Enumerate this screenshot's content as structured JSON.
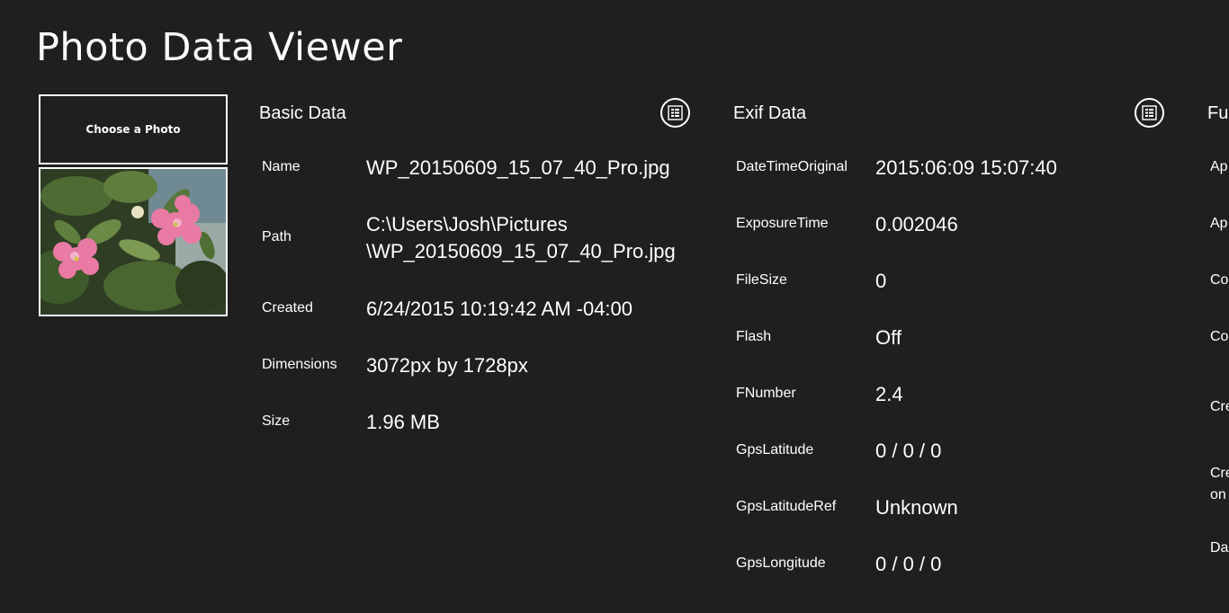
{
  "app": {
    "title": "Photo Data Viewer",
    "choose_button": "Choose a Photo"
  },
  "basic": {
    "header": "Basic Data",
    "rows": [
      {
        "label": "Name",
        "value": "WP_20150609_15_07_40_Pro.jpg"
      },
      {
        "label": "Path",
        "value_line1": "C:\\Users\\Josh\\Pictures",
        "value_line2": "\\WP_20150609_15_07_40_Pro.jpg"
      },
      {
        "label": "Created",
        "value": "6/24/2015 10:19:42 AM -04:00"
      },
      {
        "label": "Dimensions",
        "value": "3072px by 1728px"
      },
      {
        "label": "Size",
        "value": "1.96 MB"
      }
    ]
  },
  "exif": {
    "header": "Exif Data",
    "rows": [
      {
        "label": "DateTimeOriginal",
        "value": "2015:06:09 15:07:40"
      },
      {
        "label": "ExposureTime",
        "value": "0.002046"
      },
      {
        "label": "FileSize",
        "value": "0"
      },
      {
        "label": "Flash",
        "value": "Off"
      },
      {
        "label": "FNumber",
        "value": "2.4"
      },
      {
        "label": "GpsLatitude",
        "value": "0 / 0 / 0"
      },
      {
        "label": "GpsLatitudeRef",
        "value": "Unknown"
      },
      {
        "label": "GpsLongitude",
        "value": "0 / 0 / 0"
      }
    ]
  },
  "full": {
    "header": "Fu",
    "labels": [
      "Ap",
      "Ap",
      "Co",
      "Co",
      "Cre",
      "Cre",
      "on",
      "Da"
    ]
  },
  "icons": {
    "section_toggle": "grid-view-icon",
    "photo": "flower-photo-thumbnail"
  }
}
